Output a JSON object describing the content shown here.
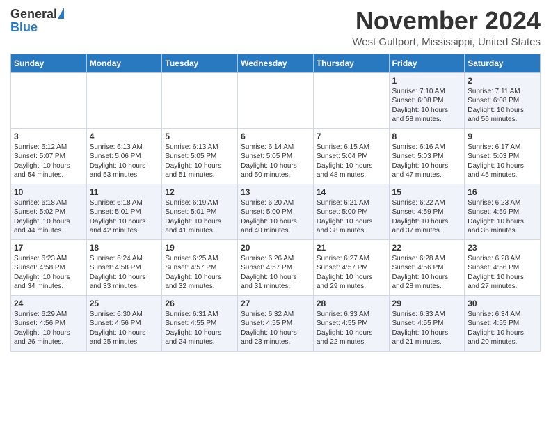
{
  "header": {
    "logo_general": "General",
    "logo_blue": "Blue",
    "month_title": "November 2024",
    "location": "West Gulfport, Mississippi, United States"
  },
  "days_of_week": [
    "Sunday",
    "Monday",
    "Tuesday",
    "Wednesday",
    "Thursday",
    "Friday",
    "Saturday"
  ],
  "weeks": [
    [
      {
        "day": "",
        "info": ""
      },
      {
        "day": "",
        "info": ""
      },
      {
        "day": "",
        "info": ""
      },
      {
        "day": "",
        "info": ""
      },
      {
        "day": "",
        "info": ""
      },
      {
        "day": "1",
        "info": "Sunrise: 7:10 AM\nSunset: 6:08 PM\nDaylight: 10 hours\nand 58 minutes."
      },
      {
        "day": "2",
        "info": "Sunrise: 7:11 AM\nSunset: 6:08 PM\nDaylight: 10 hours\nand 56 minutes."
      }
    ],
    [
      {
        "day": "3",
        "info": "Sunrise: 6:12 AM\nSunset: 5:07 PM\nDaylight: 10 hours\nand 54 minutes."
      },
      {
        "day": "4",
        "info": "Sunrise: 6:13 AM\nSunset: 5:06 PM\nDaylight: 10 hours\nand 53 minutes."
      },
      {
        "day": "5",
        "info": "Sunrise: 6:13 AM\nSunset: 5:05 PM\nDaylight: 10 hours\nand 51 minutes."
      },
      {
        "day": "6",
        "info": "Sunrise: 6:14 AM\nSunset: 5:05 PM\nDaylight: 10 hours\nand 50 minutes."
      },
      {
        "day": "7",
        "info": "Sunrise: 6:15 AM\nSunset: 5:04 PM\nDaylight: 10 hours\nand 48 minutes."
      },
      {
        "day": "8",
        "info": "Sunrise: 6:16 AM\nSunset: 5:03 PM\nDaylight: 10 hours\nand 47 minutes."
      },
      {
        "day": "9",
        "info": "Sunrise: 6:17 AM\nSunset: 5:03 PM\nDaylight: 10 hours\nand 45 minutes."
      }
    ],
    [
      {
        "day": "10",
        "info": "Sunrise: 6:18 AM\nSunset: 5:02 PM\nDaylight: 10 hours\nand 44 minutes."
      },
      {
        "day": "11",
        "info": "Sunrise: 6:18 AM\nSunset: 5:01 PM\nDaylight: 10 hours\nand 42 minutes."
      },
      {
        "day": "12",
        "info": "Sunrise: 6:19 AM\nSunset: 5:01 PM\nDaylight: 10 hours\nand 41 minutes."
      },
      {
        "day": "13",
        "info": "Sunrise: 6:20 AM\nSunset: 5:00 PM\nDaylight: 10 hours\nand 40 minutes."
      },
      {
        "day": "14",
        "info": "Sunrise: 6:21 AM\nSunset: 5:00 PM\nDaylight: 10 hours\nand 38 minutes."
      },
      {
        "day": "15",
        "info": "Sunrise: 6:22 AM\nSunset: 4:59 PM\nDaylight: 10 hours\nand 37 minutes."
      },
      {
        "day": "16",
        "info": "Sunrise: 6:23 AM\nSunset: 4:59 PM\nDaylight: 10 hours\nand 36 minutes."
      }
    ],
    [
      {
        "day": "17",
        "info": "Sunrise: 6:23 AM\nSunset: 4:58 PM\nDaylight: 10 hours\nand 34 minutes."
      },
      {
        "day": "18",
        "info": "Sunrise: 6:24 AM\nSunset: 4:58 PM\nDaylight: 10 hours\nand 33 minutes."
      },
      {
        "day": "19",
        "info": "Sunrise: 6:25 AM\nSunset: 4:57 PM\nDaylight: 10 hours\nand 32 minutes."
      },
      {
        "day": "20",
        "info": "Sunrise: 6:26 AM\nSunset: 4:57 PM\nDaylight: 10 hours\nand 31 minutes."
      },
      {
        "day": "21",
        "info": "Sunrise: 6:27 AM\nSunset: 4:57 PM\nDaylight: 10 hours\nand 29 minutes."
      },
      {
        "day": "22",
        "info": "Sunrise: 6:28 AM\nSunset: 4:56 PM\nDaylight: 10 hours\nand 28 minutes."
      },
      {
        "day": "23",
        "info": "Sunrise: 6:28 AM\nSunset: 4:56 PM\nDaylight: 10 hours\nand 27 minutes."
      }
    ],
    [
      {
        "day": "24",
        "info": "Sunrise: 6:29 AM\nSunset: 4:56 PM\nDaylight: 10 hours\nand 26 minutes."
      },
      {
        "day": "25",
        "info": "Sunrise: 6:30 AM\nSunset: 4:56 PM\nDaylight: 10 hours\nand 25 minutes."
      },
      {
        "day": "26",
        "info": "Sunrise: 6:31 AM\nSunset: 4:55 PM\nDaylight: 10 hours\nand 24 minutes."
      },
      {
        "day": "27",
        "info": "Sunrise: 6:32 AM\nSunset: 4:55 PM\nDaylight: 10 hours\nand 23 minutes."
      },
      {
        "day": "28",
        "info": "Sunrise: 6:33 AM\nSunset: 4:55 PM\nDaylight: 10 hours\nand 22 minutes."
      },
      {
        "day": "29",
        "info": "Sunrise: 6:33 AM\nSunset: 4:55 PM\nDaylight: 10 hours\nand 21 minutes."
      },
      {
        "day": "30",
        "info": "Sunrise: 6:34 AM\nSunset: 4:55 PM\nDaylight: 10 hours\nand 20 minutes."
      }
    ]
  ]
}
